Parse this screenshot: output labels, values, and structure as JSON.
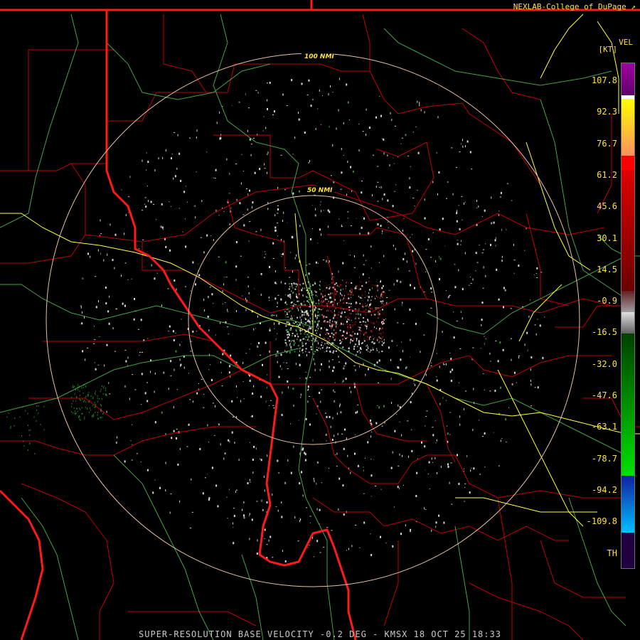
{
  "credit": "NEXLAB-College of DuPage",
  "credit_link_icon": "external-link-icon",
  "footer": "SUPER-RESOLUTION BASE VELOCITY -0.2 DEG - KMSX 18 OCT 25 18:33",
  "legend": {
    "title": "VEL",
    "unit": "[KT]",
    "ticks": [
      "107.8",
      "92.3",
      "76.7",
      "61.2",
      "45.6",
      "30.1",
      "14.5",
      "-0.9",
      "-16.5",
      "-32.0",
      "-47.6",
      "-63.1",
      "-78.7",
      "-94.2",
      "-109.8",
      "TH"
    ],
    "colors": {
      "purple": "#8a0090",
      "yellow": "#ffff00",
      "orange": "#ffa060",
      "red": "#ff0000",
      "dark_red": "#780000",
      "gray": "#a0a0a0",
      "dark_green": "#005a00",
      "green": "#00e000",
      "blue": "#0060ff",
      "cyan": "#00b0ff",
      "dark_purple": "#300050"
    }
  },
  "rings": [
    {
      "label": "50 NMI",
      "nmi": 50
    },
    {
      "label": "100 NMI",
      "nmi": 100
    }
  ],
  "boundary_colors": {
    "state": "#ff1a1a",
    "county": "#c00000",
    "highway": "#ffff40",
    "river": "#60d060",
    "ring": "#e8c0a0"
  }
}
